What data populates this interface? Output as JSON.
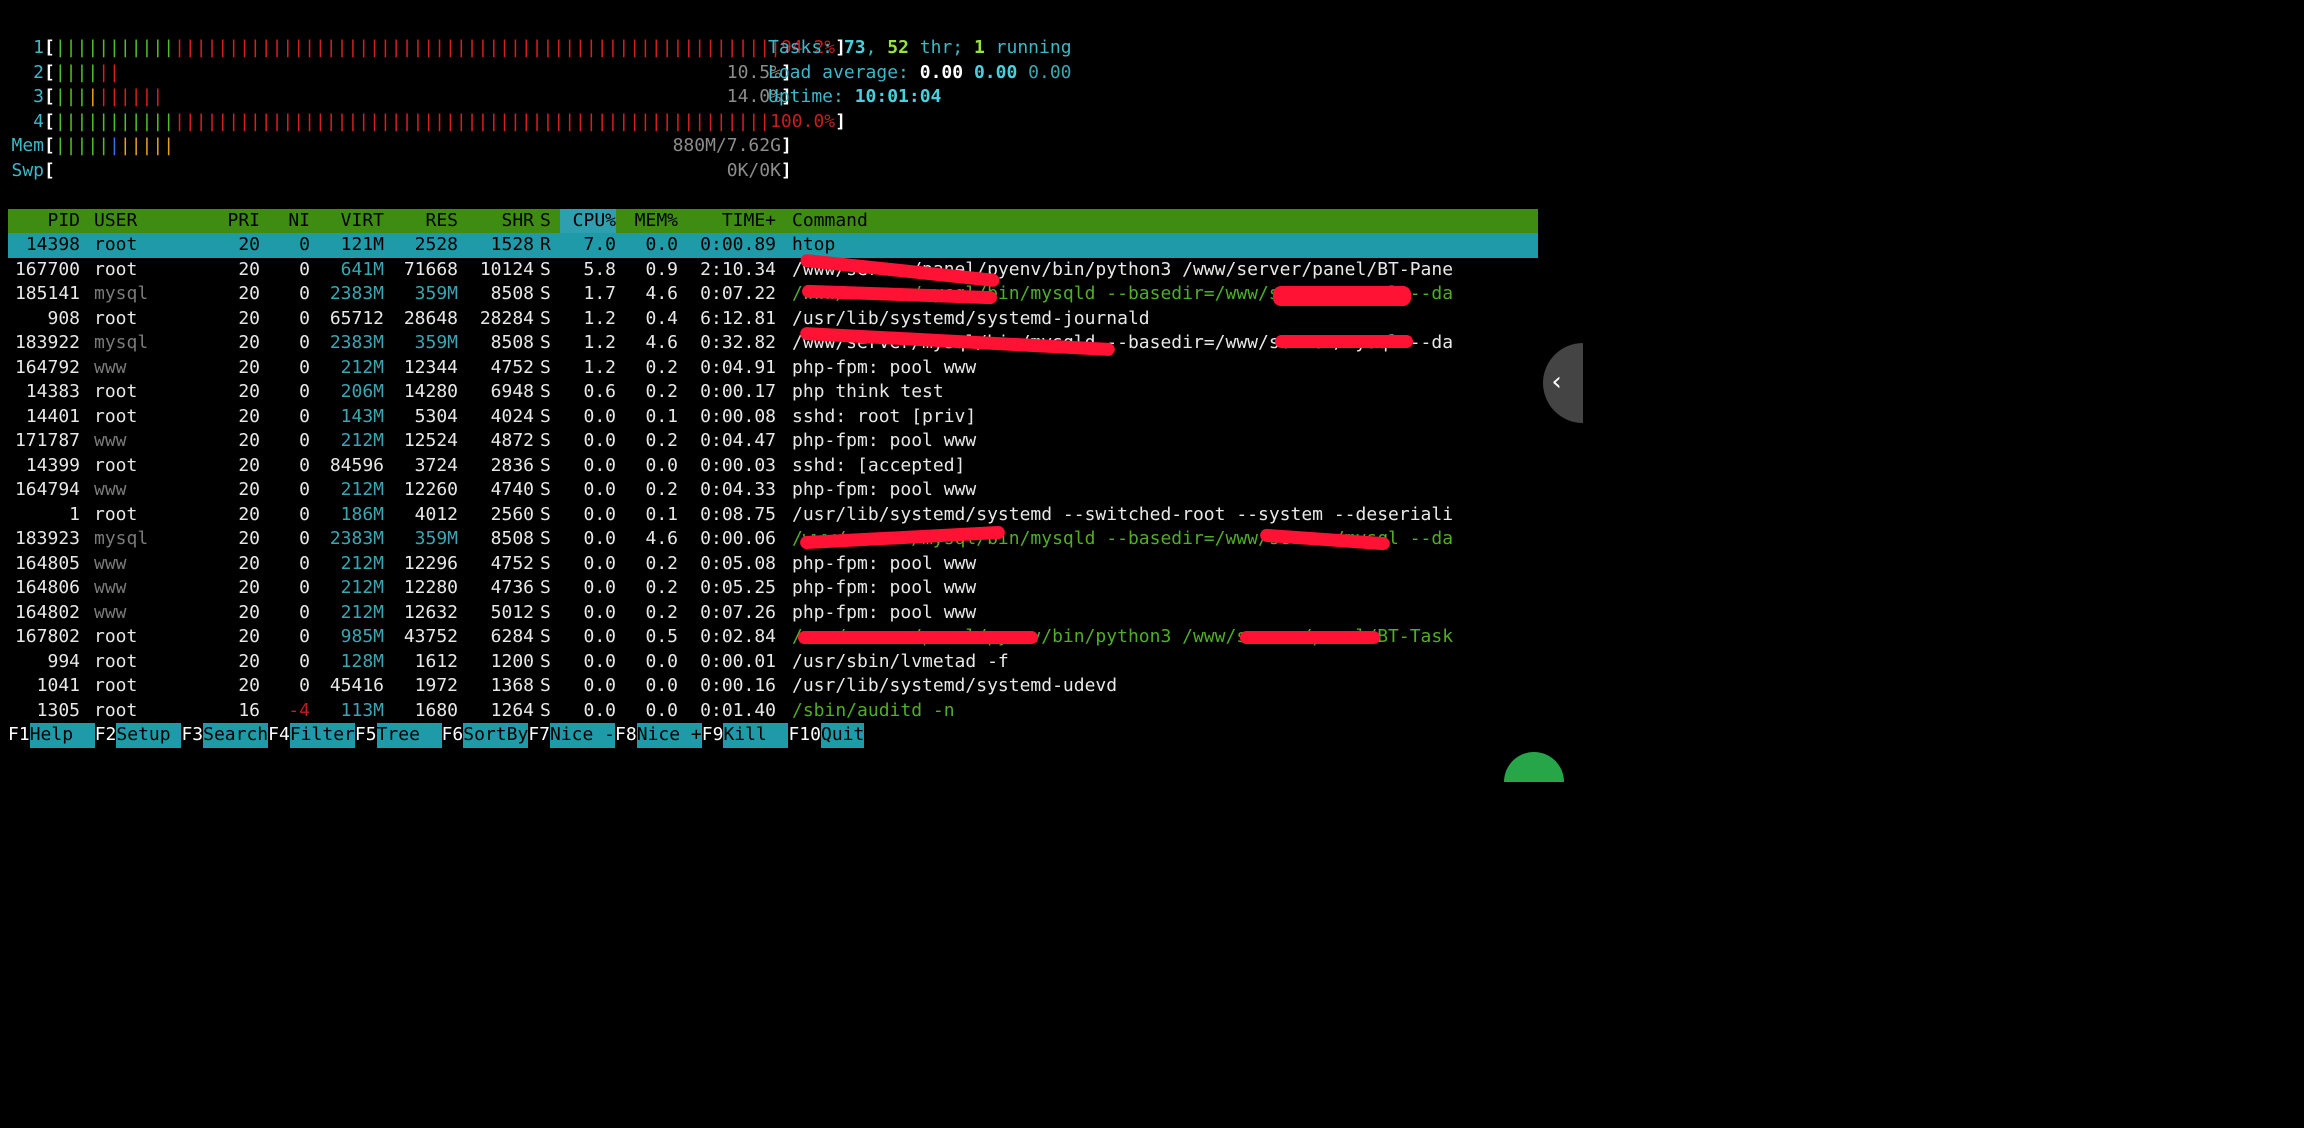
{
  "cpu_meters": [
    {
      "label": "1",
      "percent": "94.2%",
      "usage": 0.942,
      "green": 11,
      "red": 56,
      "blue": 0,
      "yellow": 0
    },
    {
      "label": "2",
      "percent": "10.5%",
      "usage": 0.105,
      "green": 4,
      "red": 2,
      "blue": 0,
      "yellow": 0
    },
    {
      "label": "3",
      "percent": "14.0%",
      "usage": 0.14,
      "green": 3,
      "red": 6,
      "blue": 0,
      "yellow": 1
    },
    {
      "label": "4",
      "percent": "100.0%",
      "usage": 1.0,
      "green": 11,
      "red": 55,
      "blue": 0,
      "yellow": 0
    }
  ],
  "mem_meter": {
    "label": "Mem",
    "value": "880M/7.62G",
    "green": 5,
    "blue": 1,
    "yellow": 5
  },
  "swap_meter": {
    "label": "Swp",
    "value": "0K/0K"
  },
  "summary": {
    "tasks_label": "Tasks:",
    "tasks": "73",
    "sep1": ",",
    "threads": "52",
    "thr_label": "thr;",
    "running": "1",
    "running_label": "running",
    "load_label": "Load average:",
    "load1": "0.00",
    "load5": "0.00",
    "load15": "0.00",
    "uptime_label": "Uptime:",
    "uptime": "10:01:04"
  },
  "columns": [
    "PID",
    "USER",
    "PRI",
    "NI",
    "VIRT",
    "RES",
    "SHR",
    "S",
    "CPU%",
    "MEM%",
    "TIME+",
    "Command"
  ],
  "sort_column": "CPU%",
  "processes": [
    {
      "pid": "14398",
      "user": "root",
      "pri": "20",
      "ni": "0",
      "virt": "121M",
      "res": "2528",
      "shr": "1528",
      "s": "R",
      "cpu": "7.0",
      "mem": "0.0",
      "time": "0:00.89",
      "cmd": "htop",
      "selected": true
    },
    {
      "pid": "167700",
      "user": "root",
      "pri": "20",
      "ni": "0",
      "virt": "641M",
      "res": "71668",
      "shr": "10124",
      "s": "S",
      "cpu": "5.8",
      "mem": "0.9",
      "time": "2:10.34",
      "cmd": "/www/server/panel/pyenv/bin/python3 /www/server/panel/BT-Pane"
    },
    {
      "pid": "185141",
      "user": "mysql",
      "pri": "20",
      "ni": "0",
      "virt": "2383M",
      "res": "359M",
      "shr": "8508",
      "s": "S",
      "cpu": "1.7",
      "mem": "4.6",
      "time": "0:07.22",
      "cmd": "/www/server/mysql/bin/mysqld --basedir=/www/server/mysql --da",
      "green": true
    },
    {
      "pid": "908",
      "user": "root",
      "pri": "20",
      "ni": "0",
      "virt": "65712",
      "res": "28648",
      "shr": "28284",
      "s": "S",
      "cpu": "1.2",
      "mem": "0.4",
      "time": "6:12.81",
      "cmd": "/usr/lib/systemd/systemd-journald"
    },
    {
      "pid": "183922",
      "user": "mysql",
      "pri": "20",
      "ni": "0",
      "virt": "2383M",
      "res": "359M",
      "shr": "8508",
      "s": "S",
      "cpu": "1.2",
      "mem": "4.6",
      "time": "0:32.82",
      "cmd": "/www/server/mysql/bin/mysqld --basedir=/www/server/mysql --da"
    },
    {
      "pid": "164792",
      "user": "www",
      "pri": "20",
      "ni": "0",
      "virt": "212M",
      "res": "12344",
      "shr": "4752",
      "s": "S",
      "cpu": "1.2",
      "mem": "0.2",
      "time": "0:04.91",
      "cmd": "php-fpm: pool www"
    },
    {
      "pid": "14383",
      "user": "root",
      "pri": "20",
      "ni": "0",
      "virt": "206M",
      "res": "14280",
      "shr": "6948",
      "s": "S",
      "cpu": "0.6",
      "mem": "0.2",
      "time": "0:00.17",
      "cmd": "php think test"
    },
    {
      "pid": "14401",
      "user": "root",
      "pri": "20",
      "ni": "0",
      "virt": "143M",
      "res": "5304",
      "shr": "4024",
      "s": "S",
      "cpu": "0.0",
      "mem": "0.1",
      "time": "0:00.08",
      "cmd": "sshd: root [priv]"
    },
    {
      "pid": "171787",
      "user": "www",
      "pri": "20",
      "ni": "0",
      "virt": "212M",
      "res": "12524",
      "shr": "4872",
      "s": "S",
      "cpu": "0.0",
      "mem": "0.2",
      "time": "0:04.47",
      "cmd": "php-fpm: pool www"
    },
    {
      "pid": "14399",
      "user": "root",
      "pri": "20",
      "ni": "0",
      "virt": "84596",
      "res": "3724",
      "shr": "2836",
      "s": "S",
      "cpu": "0.0",
      "mem": "0.0",
      "time": "0:00.03",
      "cmd": "sshd: [accepted]"
    },
    {
      "pid": "164794",
      "user": "www",
      "pri": "20",
      "ni": "0",
      "virt": "212M",
      "res": "12260",
      "shr": "4740",
      "s": "S",
      "cpu": "0.0",
      "mem": "0.2",
      "time": "0:04.33",
      "cmd": "php-fpm: pool www"
    },
    {
      "pid": "1",
      "user": "root",
      "pri": "20",
      "ni": "0",
      "virt": "186M",
      "res": "4012",
      "shr": "2560",
      "s": "S",
      "cpu": "0.0",
      "mem": "0.1",
      "time": "0:08.75",
      "cmd": "/usr/lib/systemd/systemd --switched-root --system --deseriali"
    },
    {
      "pid": "183923",
      "user": "mysql",
      "pri": "20",
      "ni": "0",
      "virt": "2383M",
      "res": "359M",
      "shr": "8508",
      "s": "S",
      "cpu": "0.0",
      "mem": "4.6",
      "time": "0:00.06",
      "cmd": "/www/server/mysql/bin/mysqld --basedir=/www/server/mysql --da",
      "green": true
    },
    {
      "pid": "164805",
      "user": "www",
      "pri": "20",
      "ni": "0",
      "virt": "212M",
      "res": "12296",
      "shr": "4752",
      "s": "S",
      "cpu": "0.0",
      "mem": "0.2",
      "time": "0:05.08",
      "cmd": "php-fpm: pool www"
    },
    {
      "pid": "164806",
      "user": "www",
      "pri": "20",
      "ni": "0",
      "virt": "212M",
      "res": "12280",
      "shr": "4736",
      "s": "S",
      "cpu": "0.0",
      "mem": "0.2",
      "time": "0:05.25",
      "cmd": "php-fpm: pool www"
    },
    {
      "pid": "164802",
      "user": "www",
      "pri": "20",
      "ni": "0",
      "virt": "212M",
      "res": "12632",
      "shr": "5012",
      "s": "S",
      "cpu": "0.0",
      "mem": "0.2",
      "time": "0:07.26",
      "cmd": "php-fpm: pool www"
    },
    {
      "pid": "167802",
      "user": "root",
      "pri": "20",
      "ni": "0",
      "virt": "985M",
      "res": "43752",
      "shr": "6284",
      "s": "S",
      "cpu": "0.0",
      "mem": "0.5",
      "time": "0:02.84",
      "cmd": "/www/server/panel/pyenv/bin/python3 /www/server/panel/BT-Task",
      "green": true
    },
    {
      "pid": "994",
      "user": "root",
      "pri": "20",
      "ni": "0",
      "virt": "128M",
      "res": "1612",
      "shr": "1200",
      "s": "S",
      "cpu": "0.0",
      "mem": "0.0",
      "time": "0:00.01",
      "cmd": "/usr/sbin/lvmetad -f"
    },
    {
      "pid": "1041",
      "user": "root",
      "pri": "20",
      "ni": "0",
      "virt": "45416",
      "res": "1972",
      "shr": "1368",
      "s": "S",
      "cpu": "0.0",
      "mem": "0.0",
      "time": "0:00.16",
      "cmd": "/usr/lib/systemd/systemd-udevd"
    },
    {
      "pid": "1305",
      "user": "root",
      "pri": "16",
      "ni": "-4",
      "virt": "113M",
      "res": "1680",
      "shr": "1264",
      "s": "S",
      "cpu": "0.0",
      "mem": "0.0",
      "time": "0:01.40",
      "cmd": "/sbin/auditd -n",
      "green": true
    }
  ],
  "footer": [
    {
      "key": "F1",
      "label": "Help  "
    },
    {
      "key": "F2",
      "label": "Setup "
    },
    {
      "key": "F3",
      "label": "Search"
    },
    {
      "key": "F4",
      "label": "Filter"
    },
    {
      "key": "F5",
      "label": "Tree  "
    },
    {
      "key": "F6",
      "label": "SortBy"
    },
    {
      "key": "F7",
      "label": "Nice -"
    },
    {
      "key": "F8",
      "label": "Nice +"
    },
    {
      "key": "F9",
      "label": "Kill  "
    },
    {
      "key": "F10",
      "label": "Quit"
    }
  ],
  "colors": {
    "header_bg": "#3e8c12",
    "selected_bg": "#1f9aa8",
    "sort_bg": "#2d9fae",
    "redaction": "#ff1233"
  },
  "icons": {
    "side_tab": "chevron-left-icon"
  }
}
